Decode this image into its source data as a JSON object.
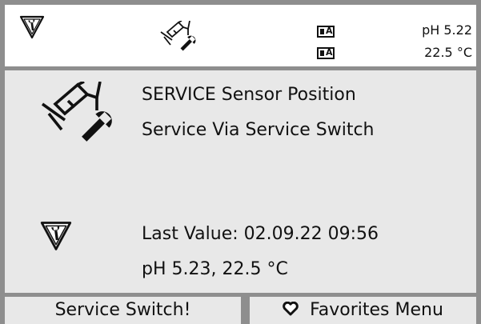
{
  "header": {
    "status_icon": "service-wrench-triangle-icon",
    "mode_icon": "sensor-service-icon",
    "badge_1": {
      "icon": "sensor-a-badge-icon",
      "letter": "A"
    },
    "badge_2": {
      "icon": "sensor-a-badge-icon",
      "letter": "A"
    },
    "ph_value": "pH 5.22",
    "temperature_value": "22.5 °C"
  },
  "main": {
    "sensor_icon": "sensor-service-icon",
    "title": "SERVICE Sensor Position",
    "subtitle": "Service Via Service Switch",
    "warning_icon": "service-wrench-triangle-icon",
    "last_value": "Last Value: 02.09.22 09:56",
    "last_reading": "pH 5.23, 22.5 °C"
  },
  "footer": {
    "left_softkey": "Service Switch!",
    "right_softkey": "Favorites Menu",
    "right_softkey_icon": "heart-icon"
  },
  "colors": {
    "frame": "#8e8e8e",
    "panel": "#e8e8e8",
    "header_bg": "#ffffff",
    "ink": "#111111"
  }
}
